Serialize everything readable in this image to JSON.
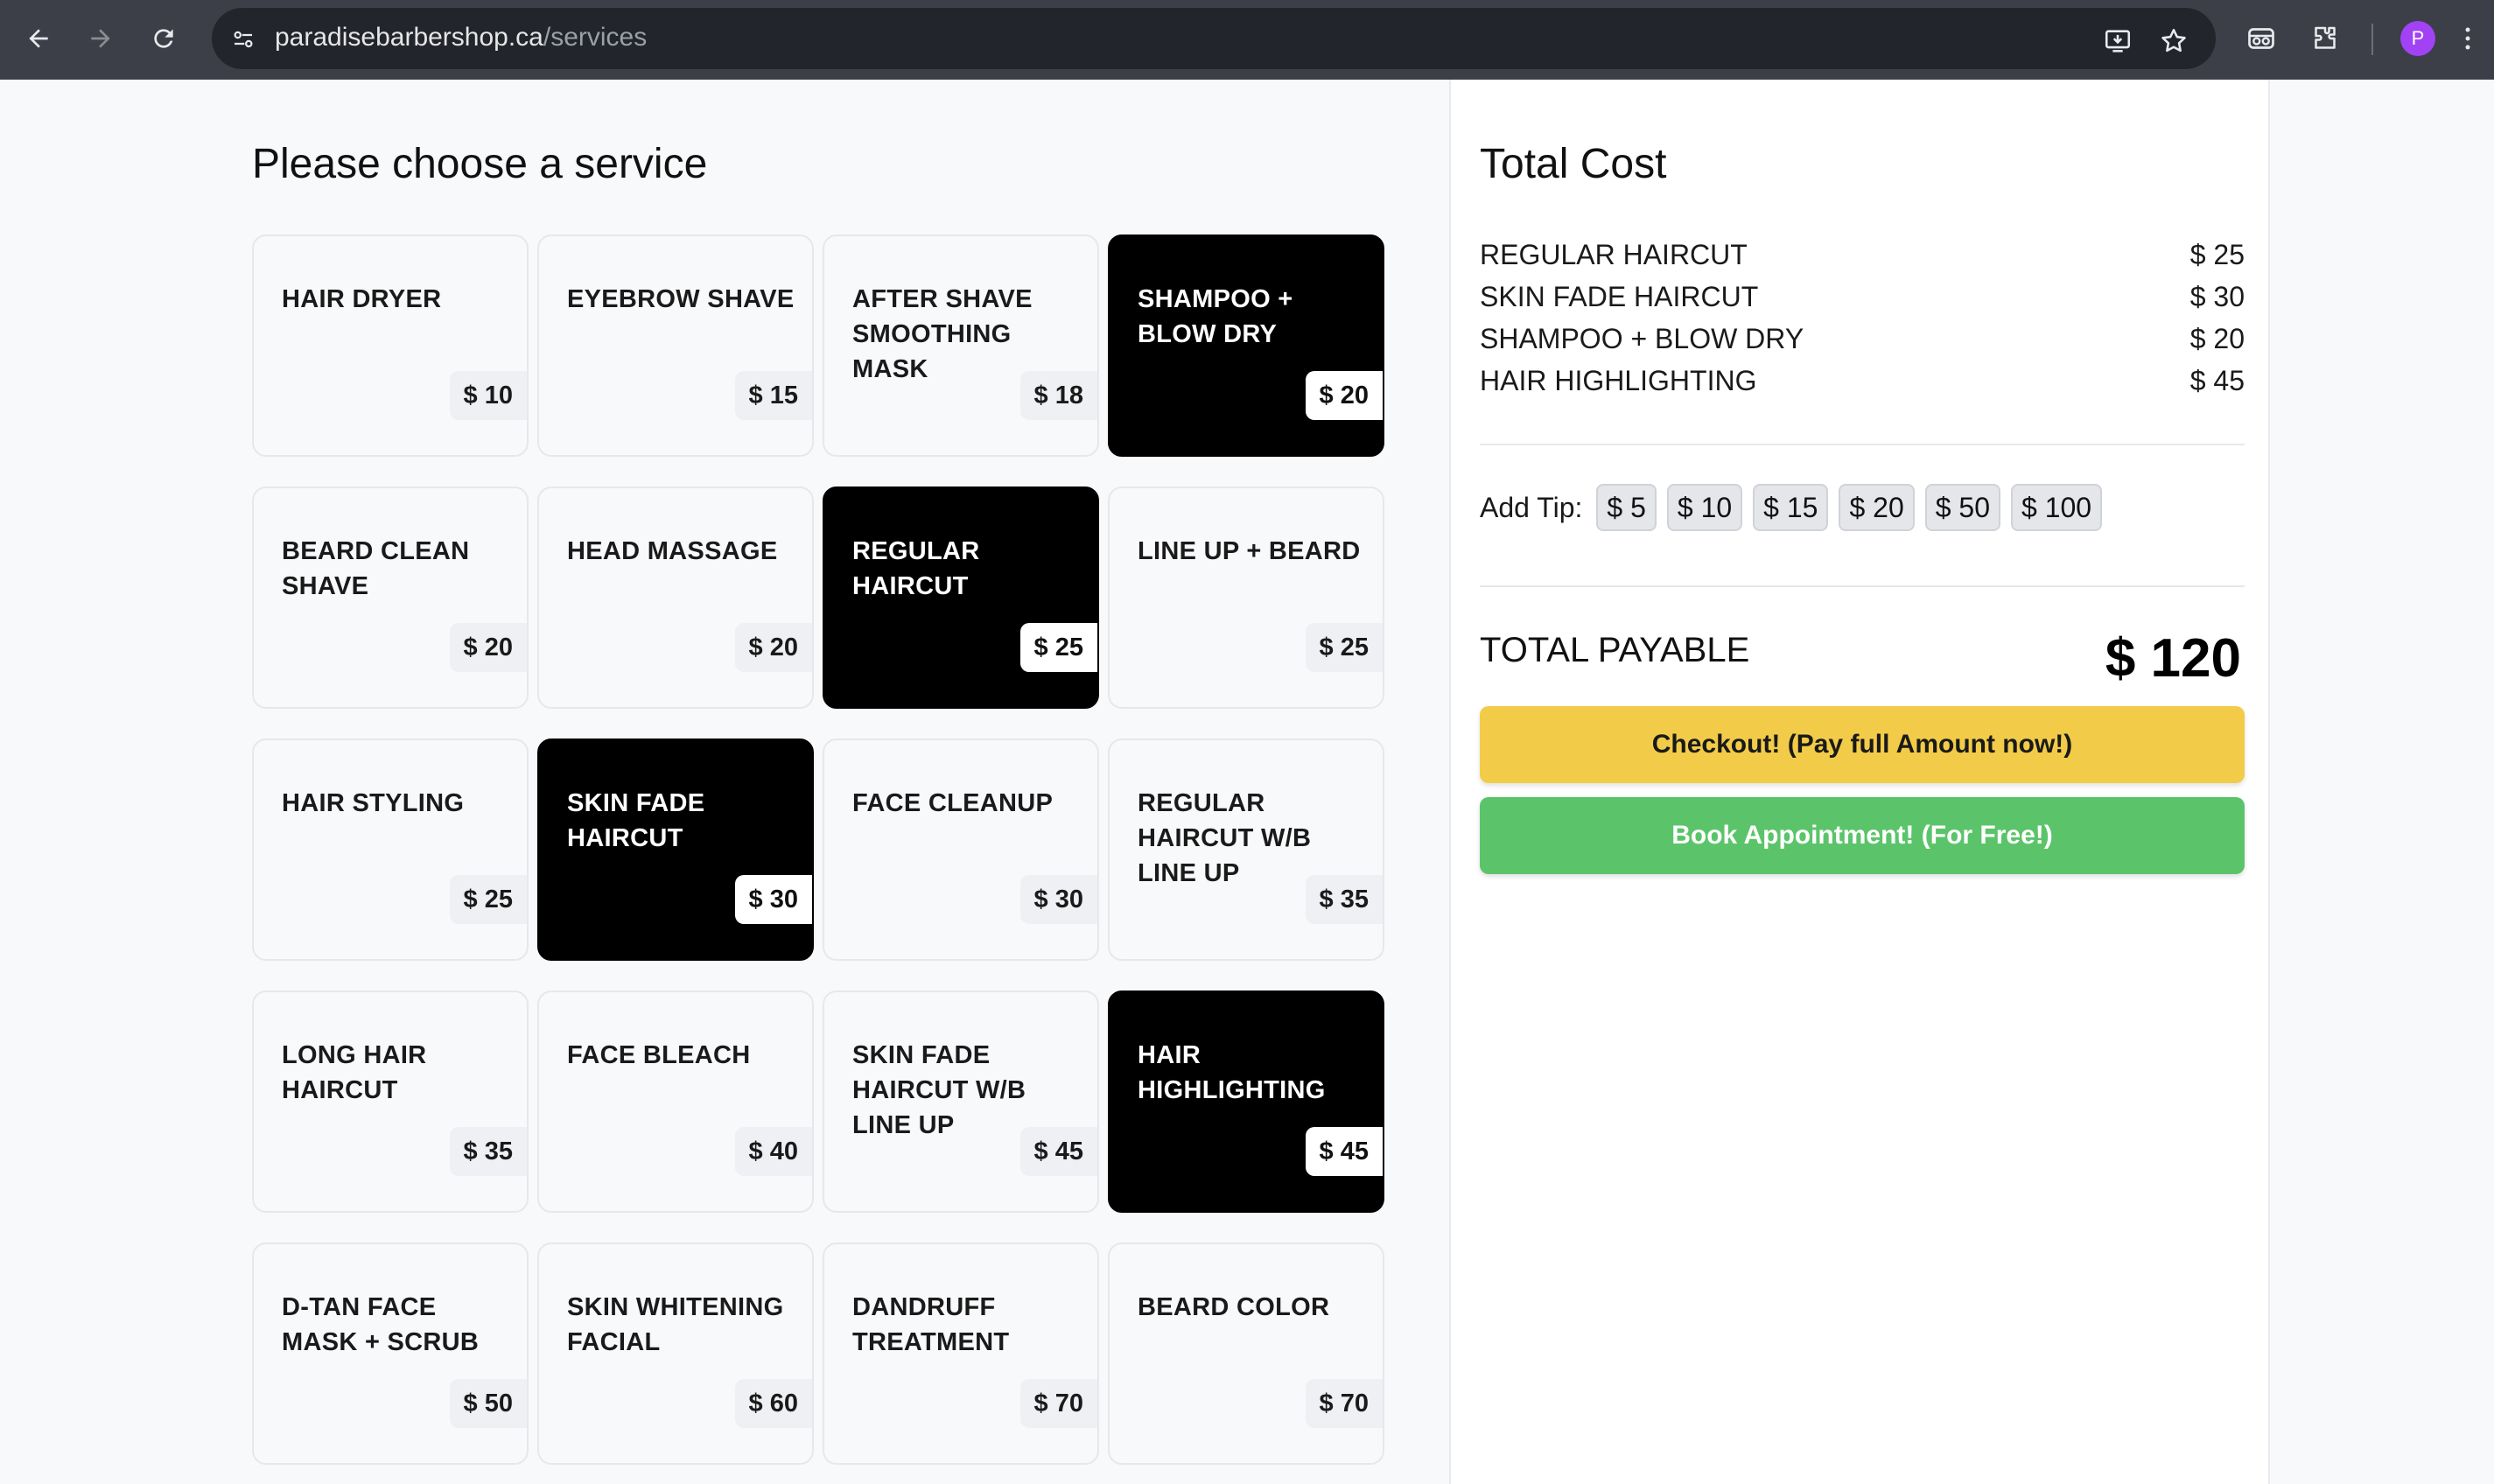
{
  "browser": {
    "url_domain": "paradisebarbershop.ca",
    "url_path": "/services",
    "profile_initial": "P"
  },
  "services": {
    "heading": "Please choose a service",
    "items": [
      {
        "name": "HAIR DRYER",
        "price": "$ 10",
        "selected": false
      },
      {
        "name": "EYEBROW SHAVE",
        "price": "$ 15",
        "selected": false
      },
      {
        "name": "AFTER SHAVE SMOOTHING MASK",
        "price": "$ 18",
        "selected": false
      },
      {
        "name": "SHAMPOO + BLOW DRY",
        "price": "$ 20",
        "selected": true
      },
      {
        "name": "BEARD CLEAN SHAVE",
        "price": "$ 20",
        "selected": false
      },
      {
        "name": "HEAD MASSAGE",
        "price": "$ 20",
        "selected": false
      },
      {
        "name": "REGULAR HAIRCUT",
        "price": "$ 25",
        "selected": true
      },
      {
        "name": "LINE UP + BEARD",
        "price": "$ 25",
        "selected": false
      },
      {
        "name": "HAIR STYLING",
        "price": "$ 25",
        "selected": false
      },
      {
        "name": "SKIN FADE HAIRCUT",
        "price": "$ 30",
        "selected": true
      },
      {
        "name": "FACE CLEANUP",
        "price": "$ 30",
        "selected": false
      },
      {
        "name": "REGULAR HAIRCUT W/B LINE UP",
        "price": "$ 35",
        "selected": false
      },
      {
        "name": "LONG HAIR HAIRCUT",
        "price": "$ 35",
        "selected": false
      },
      {
        "name": "FACE BLEACH",
        "price": "$ 40",
        "selected": false
      },
      {
        "name": "SKIN FADE HAIRCUT W/B LINE UP",
        "price": "$ 45",
        "selected": false
      },
      {
        "name": "HAIR HIGHLIGHTING",
        "price": "$ 45",
        "selected": true
      },
      {
        "name": "D-TAN FACE MASK + SCRUB",
        "price": "$ 50",
        "selected": false
      },
      {
        "name": "SKIN WHITENING FACIAL",
        "price": "$ 60",
        "selected": false
      },
      {
        "name": "DANDRUFF TREATMENT",
        "price": "$ 70",
        "selected": false
      },
      {
        "name": "BEARD COLOR",
        "price": "$ 70",
        "selected": false
      }
    ]
  },
  "summary": {
    "title": "Total Cost",
    "line_items": [
      {
        "name": "REGULAR HAIRCUT",
        "price": "$ 25"
      },
      {
        "name": "SKIN FADE HAIRCUT",
        "price": "$ 30"
      },
      {
        "name": "SHAMPOO + BLOW DRY",
        "price": "$ 20"
      },
      {
        "name": "HAIR HIGHLIGHTING",
        "price": "$ 45"
      }
    ],
    "tip_label": "Add Tip:",
    "tip_options": [
      "$ 5",
      "$ 10",
      "$ 15",
      "$ 20",
      "$ 50",
      "$ 100"
    ],
    "total_label": "TOTAL PAYABLE",
    "total_value": "$ 120",
    "checkout_label": "Checkout! (Pay full Amount now!)",
    "book_label": "Book Appointment! (For Free!)"
  },
  "colors": {
    "checkout": "#f2cc48",
    "book": "#5bc46a",
    "selected_card": "#000000",
    "avatar": "#a142f4"
  }
}
